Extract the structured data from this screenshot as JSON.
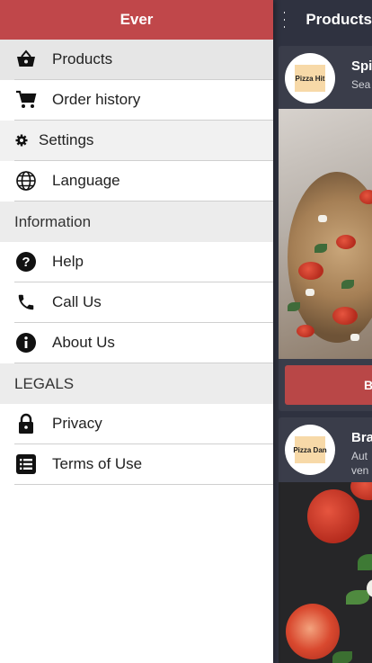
{
  "app_bar": {
    "title": "Products"
  },
  "drawer": {
    "brand": "Ever",
    "items": [
      {
        "label": "Products",
        "icon": "basket-icon",
        "active": true
      },
      {
        "label": "Order history",
        "icon": "cart-icon"
      },
      {
        "label": "Settings",
        "icon": "gear-icon"
      },
      {
        "label": "Language",
        "icon": "globe-icon"
      }
    ],
    "info_header": "Information",
    "info_items": [
      {
        "label": "Help",
        "icon": "help-circle-icon"
      },
      {
        "label": "Call Us",
        "icon": "phone-icon"
      },
      {
        "label": "About Us",
        "icon": "info-circle-icon"
      }
    ],
    "legals_header": "LEGALS",
    "legal_items": [
      {
        "label": "Privacy",
        "icon": "lock-icon"
      },
      {
        "label": "Terms of Use",
        "icon": "list-icon"
      }
    ]
  },
  "products": [
    {
      "title": "Spi",
      "subtitle": "Sea",
      "logo_text": "Pizza Hit",
      "button_label": "B"
    },
    {
      "title": "Bra",
      "subtitle_lines": [
        "Aut",
        "ven"
      ],
      "logo_text": "Pizza Dan"
    }
  ],
  "colors": {
    "accent": "#c0474a",
    "button": "#b94747",
    "app_bg": "#2f3240",
    "card_bg": "#3a3d4a"
  }
}
